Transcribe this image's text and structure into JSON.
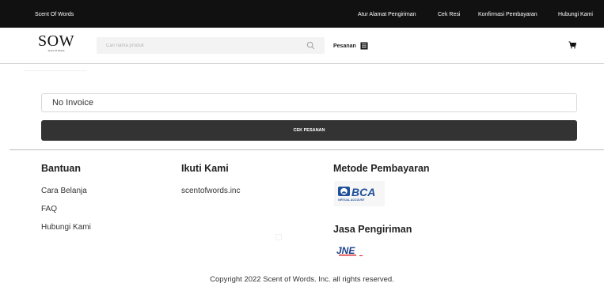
{
  "topbar": {
    "brand": "Scent Of Words",
    "links": [
      "Atur Alamat Pengiriman",
      "Cek Resi",
      "Konfirmasi Pembayaran",
      "Hubungi Kami"
    ]
  },
  "header": {
    "logo": {
      "main": "SOW",
      "sub": "Scent Of Words"
    },
    "search": {
      "placeholder": "Cari nama produk",
      "icon": "search-icon"
    },
    "orders_label": "Pesanan",
    "orders_icon": "list-icon",
    "cart_icon": "cart-icon"
  },
  "main": {
    "invoice": {
      "value": "No Invoice",
      "placeholder": ""
    },
    "check_button": "CEK PESANAN"
  },
  "footer": {
    "help": {
      "title": "Bantuan",
      "links": [
        "Cara Belanja",
        "FAQ",
        "Hubungi Kami"
      ]
    },
    "follow": {
      "title": "Ikuti Kami",
      "links": [
        "scentofwords.inc"
      ]
    },
    "payment": {
      "title": "Metode Pembayaran",
      "logos": [
        {
          "name": "BCA",
          "sub": "VIRTUAL ACCOUNT"
        }
      ]
    },
    "shipping": {
      "title": "Jasa Pengiriman",
      "logos": [
        {
          "name": "JNE"
        }
      ]
    },
    "copyright": "Copyright 2022 Scent of Words. Inc. all rights reserved."
  },
  "colors": {
    "topbar_bg": "#111111",
    "button_bg": "#333333",
    "bca_blue": "#1f4f9a",
    "jne_red": "#d71920",
    "jne_blue": "#163e8a"
  }
}
